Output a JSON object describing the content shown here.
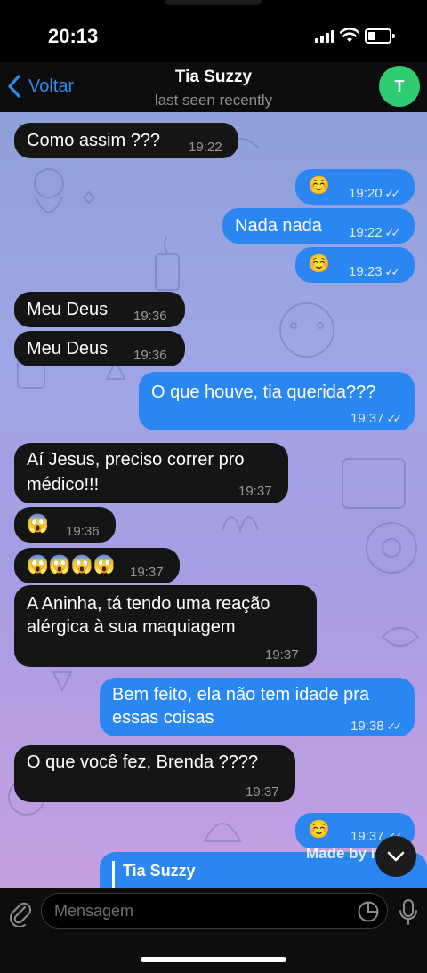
{
  "status": {
    "time": "20:13"
  },
  "header": {
    "back_label": "Voltar",
    "contact_name": "Tia Suzzy",
    "last_seen": "last seen recently",
    "avatar_letter": "T"
  },
  "messages": [
    {
      "text": "Como assim ???",
      "time": "19:22"
    },
    {
      "text": "☺️",
      "time": "19:20"
    },
    {
      "text": "Nada nada",
      "time": "19:22"
    },
    {
      "text": "☺️",
      "time": "19:23"
    },
    {
      "text": "Meu Deus",
      "time": "19:36"
    },
    {
      "text": "Meu Deus",
      "time": "19:36"
    },
    {
      "text": "O que houve, tia querida???",
      "time": "19:37"
    },
    {
      "text": "Aí Jesus, preciso correr pro",
      "text2": "médico!!!",
      "time": "19:37"
    },
    {
      "text": "😱",
      "time": "19:36"
    },
    {
      "text": "😱😱😱😱",
      "time": "19:37"
    },
    {
      "text": "A Aninha, tá tendo uma reação",
      "text2": "alérgica à sua maquiagem",
      "time": "19:37"
    },
    {
      "text": "Bem feito, ela não tem idade pra",
      "text2": "essas coisas",
      "time": "19:38"
    },
    {
      "text": "O que você fez, Brenda ????",
      "time": "19:37"
    },
    {
      "text": "☺️",
      "time": "19:37"
    }
  ],
  "reply_preview": {
    "name": "Tia Suzzy"
  },
  "watermark": "Made by iFake",
  "composer": {
    "placeholder": "Mensagem"
  },
  "colors": {
    "outgoing": "#2a86f0",
    "incoming": "#151515",
    "accent": "#2a8ef0",
    "avatar": "#2ecc71"
  }
}
